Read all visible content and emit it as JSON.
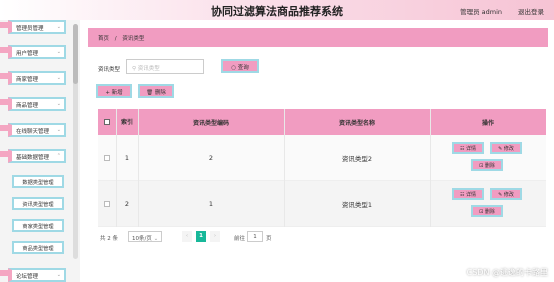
{
  "header": {
    "title": "协同过滤算法商品推荐系统",
    "admin": "管理员 admin",
    "logout": "退出登录"
  },
  "sidebar": {
    "items": [
      {
        "label": "管理员管理"
      },
      {
        "label": "用户管理"
      },
      {
        "label": "商家管理"
      },
      {
        "label": "商品管理"
      },
      {
        "label": "在线聊天管理"
      },
      {
        "label": "基础数据管理"
      }
    ],
    "sub_items": [
      {
        "label": "数据类型管理"
      },
      {
        "label": "资讯类型管理"
      },
      {
        "label": "商家类型管理"
      },
      {
        "label": "商品类型管理"
      }
    ],
    "bottom_item": {
      "label": "论坛管理"
    }
  },
  "breadcrumb": {
    "home": "首页",
    "sep": "/",
    "current": "资讯类型"
  },
  "search": {
    "label": "资讯类型",
    "placeholder": "资讯类型",
    "button": "查询"
  },
  "actions": {
    "add": "新增",
    "delete": "删除"
  },
  "table": {
    "headers": [
      "",
      "索引",
      "资讯类型编码",
      "资讯类型名称",
      "操作"
    ],
    "rows": [
      {
        "index": "1",
        "code": "2",
        "name": "资讯类型2"
      },
      {
        "index": "2",
        "code": "1",
        "name": "资讯类型1"
      }
    ],
    "row_actions": {
      "detail": "详情",
      "edit": "修改",
      "delete": "删除"
    }
  },
  "pagination": {
    "total": "共 2 条",
    "page_size": "10条/页",
    "prev": "‹",
    "current": "1",
    "next": "›",
    "goto": "前往",
    "goto_value": "1",
    "page_suffix": "页"
  },
  "watermark": "CSDN @逃逸的卡路里",
  "colors": {
    "accent": "#f19cc1",
    "border": "#9fd9e5",
    "pager_active": "#18b89a"
  }
}
